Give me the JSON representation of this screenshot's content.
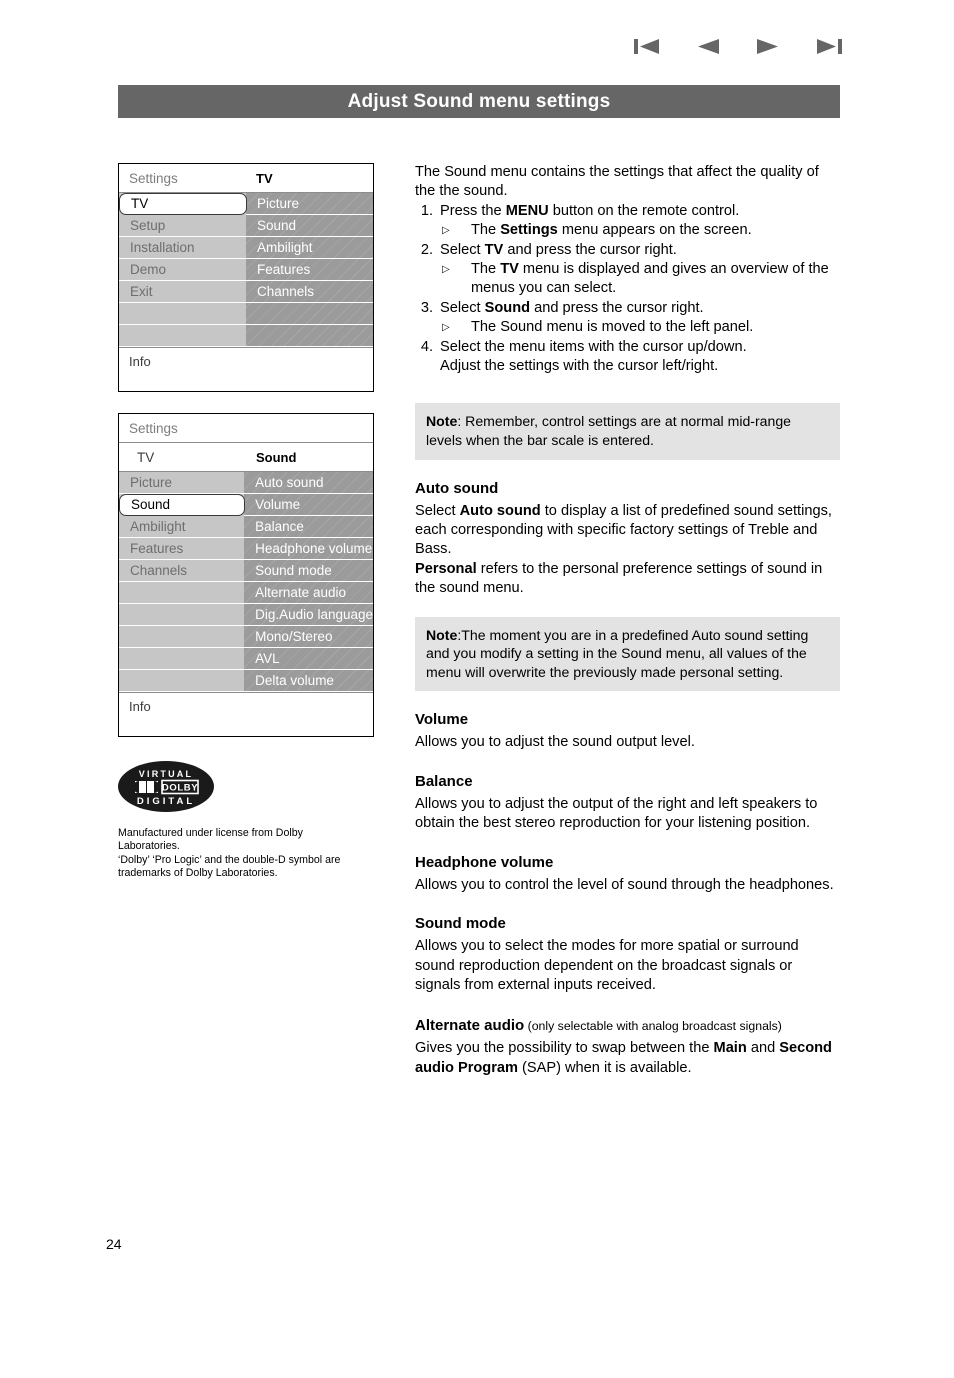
{
  "page": {
    "title": "Adjust Sound menu settings",
    "number": "24"
  },
  "nav": {
    "icons": [
      {
        "name": "first-page-icon",
        "label": "First"
      },
      {
        "name": "previous-page-icon",
        "label": "Previous"
      },
      {
        "name": "next-page-icon",
        "label": "Next"
      },
      {
        "name": "last-page-icon",
        "label": "Last"
      }
    ],
    "color": "#666666"
  },
  "osd_tv": {
    "header_left": "Settings",
    "header_right": "TV",
    "left_items": [
      "TV",
      "Setup",
      "Installation",
      "Demo",
      "Exit",
      "",
      ""
    ],
    "left_selected_index": 0,
    "right_items": [
      "Picture",
      "Sound",
      "Ambilight",
      "Features",
      "Channels",
      "",
      ""
    ],
    "info": "Info"
  },
  "osd_sound": {
    "header_left": "Settings",
    "header_right": "",
    "subhead_left": "TV",
    "subhead_right": "Sound",
    "left_items": [
      "Picture",
      "Sound",
      "Ambilight",
      "Features",
      "Channels",
      "",
      "",
      "",
      "",
      ""
    ],
    "left_selected_index": 1,
    "right_items": [
      "Auto sound",
      "Volume",
      "Balance",
      "Headphone volume",
      "Sound mode",
      "Alternate audio",
      "Dig.Audio language",
      "Mono/Stereo",
      "AVL",
      "Delta volume"
    ],
    "info": "Info"
  },
  "dolby": {
    "logo_top": "VIRTUAL",
    "logo_mid": "DOLBY",
    "logo_bottom": "DIGITAL",
    "credit_line_1": "Manufactured under license from Dolby",
    "credit_line_2": "Laboratories.",
    "credit_line_3": "‘Dolby’ ‘Pro Logic’ and the double-D symbol are",
    "credit_line_4": "trademarks of Dolby Laboratories."
  },
  "content": {
    "intro": "The Sound menu contains the settings that affect the quality of the the sound.",
    "steps": [
      {
        "num": "1.",
        "text_before": "Press the ",
        "bold": "MENU",
        "text_after": " button on the remote control.",
        "sub_before": "The ",
        "sub_bold": "Settings",
        "sub_after": " menu appears on the screen."
      },
      {
        "num": "2.",
        "text_before": "Select ",
        "bold": "TV",
        "text_after": " and press the cursor right.",
        "sub_before": "The ",
        "sub_bold": "TV",
        "sub_after": " menu is displayed and gives an overview of the",
        "sub_cont": "menus you can select."
      },
      {
        "num": "3.",
        "text_before": "Select ",
        "bold": "Sound",
        "text_after": " and press the cursor right.",
        "sub_before": "The Sound menu is moved to the left panel.",
        "sub_bold": "",
        "sub_after": ""
      },
      {
        "num": "4.",
        "text_before": "Select the menu items with the cursor up/down.",
        "bold": "",
        "text_after": "",
        "line2": "Adjust the settings with the cursor left/right."
      }
    ],
    "note_1": {
      "label": "Note",
      "text": ": Remember, control settings are at normal mid-range levels when the bar scale is entered."
    },
    "note_2": {
      "label": "Note",
      "text": ":The moment you are in a predefined Auto sound setting and you modify a setting in the Sound menu, all values of the menu will overwrite the previously made personal setting."
    },
    "sections": [
      {
        "heading": "Auto sound",
        "part_1_before": "Select ",
        "part_1_bold": "Auto sound",
        "part_1_after": " to display a list of predefined sound settings, each corresponding with specific factory settings of Treble and Bass.",
        "part_2_bold": "Personal",
        "part_2_after": " refers to the personal preference settings of sound in the sound menu."
      },
      {
        "heading": "Volume",
        "body": "Allows you to adjust the sound output level."
      },
      {
        "heading": "Balance",
        "body": "Allows you to adjust the output of the right and left speakers to obtain the best stereo reproduction for your listening position."
      },
      {
        "heading": "Headphone volume",
        "body": "Allows you to control the level of sound through the headphones."
      },
      {
        "heading": "Sound mode",
        "body": "Allows you to select the modes for more spatial or surround sound reproduction dependent on the broadcast signals or signals from external inputs received."
      }
    ],
    "alternate_audio": {
      "heading_bold": "Alternate audio",
      "heading_small": " (only selectable with analog broadcast signals)",
      "body_1": "Gives you the possibility to swap between the ",
      "body_bold_1": "Main",
      "body_2": " and ",
      "body_bold_2": "Second audio Program",
      "body_3": " (SAP) when it is available."
    }
  }
}
